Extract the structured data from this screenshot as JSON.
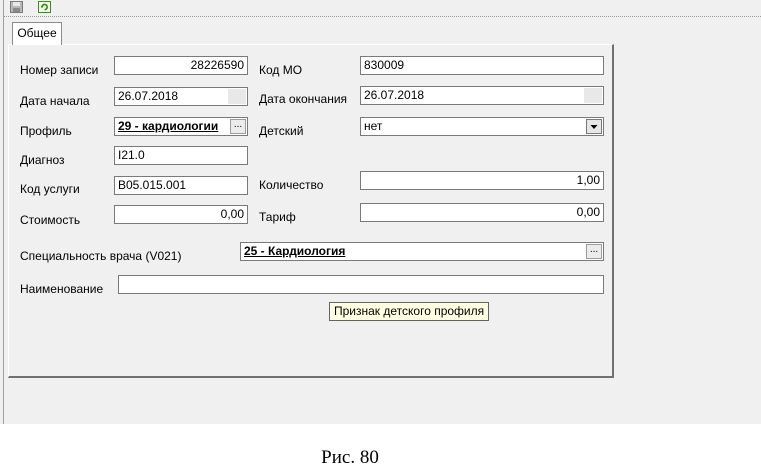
{
  "toolbar": {
    "buttons": [
      {
        "icon": "save-icon"
      },
      {
        "icon": "refresh-icon"
      }
    ]
  },
  "tabs": [
    {
      "label": "Общее"
    }
  ],
  "form": {
    "record_number": {
      "label": "Номер записи",
      "value": "28226590"
    },
    "mo_code": {
      "label": "Код МО",
      "value": "830009"
    },
    "start_date": {
      "label": "Дата начала",
      "value": "26.07.2018"
    },
    "end_date": {
      "label": "Дата окончания",
      "value": "26.07.2018"
    },
    "profile": {
      "label": "Профиль",
      "value": "29 - кардиологии",
      "button": "..."
    },
    "children": {
      "label": "Детский",
      "value": "нет"
    },
    "diagnosis": {
      "label": "Диагноз",
      "value": "I21.0"
    },
    "service_code": {
      "label": "Код услуги",
      "value": "B05.015.001"
    },
    "quantity": {
      "label": "Количество",
      "value": "1,00"
    },
    "cost": {
      "label": "Стоимость",
      "value": "0,00"
    },
    "tariff": {
      "label": "Тариф",
      "value": "0,00"
    },
    "specialty": {
      "label": "Специальность врача (V021)",
      "value": "25 - Кардиология",
      "button": "..."
    },
    "name": {
      "label": "Наименование",
      "value": ""
    }
  },
  "tooltip": "Признак детского профиля",
  "caption": "Рис. 80",
  "colors": {
    "window": "#f0f0f0",
    "tooltip": "#ffffe1",
    "border": "#7a7a7a"
  }
}
